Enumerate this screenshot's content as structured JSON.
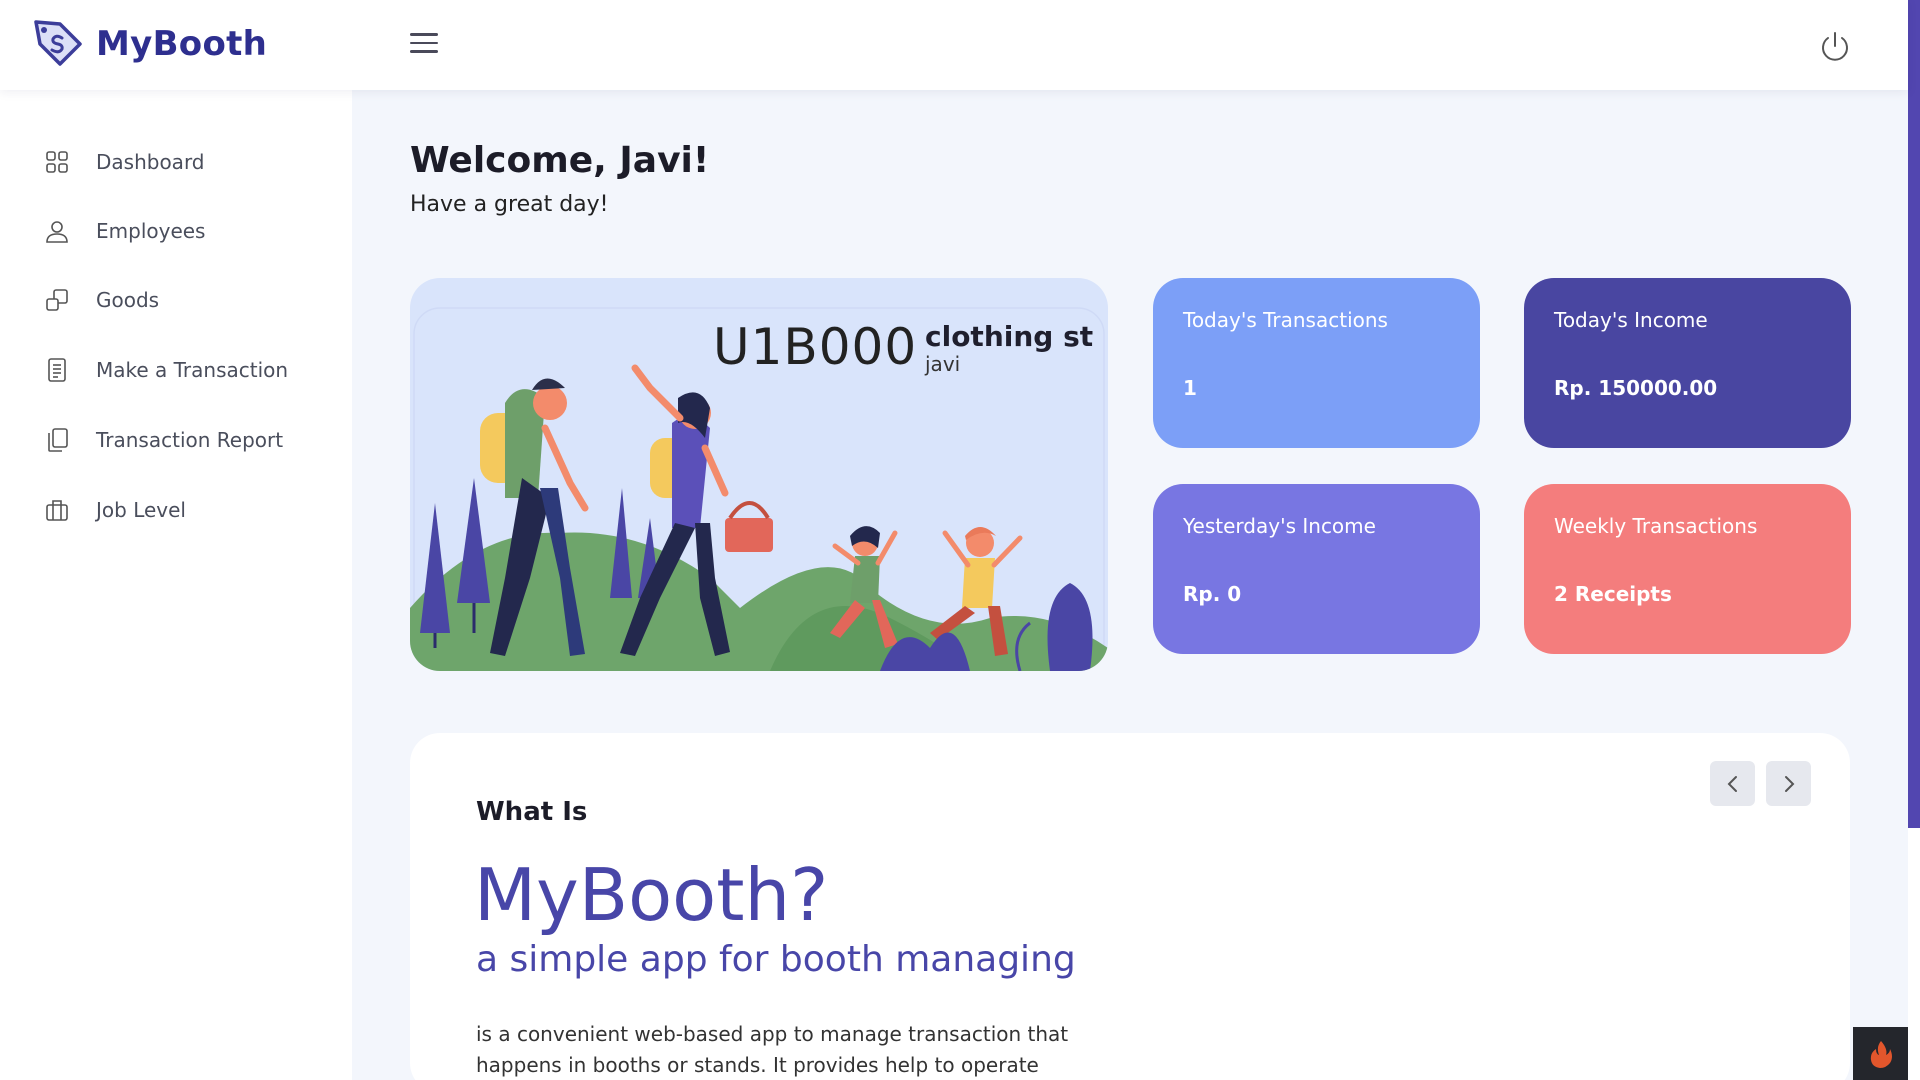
{
  "app": {
    "name": "MyBooth"
  },
  "sidebar": {
    "items": [
      {
        "label": "Dashboard",
        "icon": "grid-icon"
      },
      {
        "label": "Employees",
        "icon": "user-icon"
      },
      {
        "label": "Goods",
        "icon": "boxes-icon"
      },
      {
        "label": "Make a Transaction",
        "icon": "document-icon"
      },
      {
        "label": "Transaction Report",
        "icon": "copy-icon"
      },
      {
        "label": "Job Level",
        "icon": "briefcase-icon"
      }
    ]
  },
  "main": {
    "welcome": "Welcome, Javi!",
    "subtitle": "Have a great day!",
    "booth": {
      "code": "U1B000",
      "name": "clothing st",
      "user": "javi"
    },
    "stats": [
      {
        "label": "Today's Transactions",
        "value": "1",
        "color": "#7c9ff7"
      },
      {
        "label": "Today's Income",
        "value": "Rp. 150000.00",
        "color": "#4946a1"
      },
      {
        "label": "Yesterday's Income",
        "value": "Rp. 0",
        "color": "#7876e2"
      },
      {
        "label": "Weekly Transactions",
        "value": "2 Receipts",
        "color": "#f47d7d"
      }
    ],
    "about": {
      "kicker": "What Is",
      "title": "MyBooth?",
      "tagline": "a simple app for booth managing",
      "description": "is a convenient web-based app to manage transaction that happens in booths or stands. It provides help to operate your"
    }
  },
  "colors": {
    "brand": "#2e2f8f",
    "accent": "#4846a8",
    "background": "#f3f6fc"
  }
}
